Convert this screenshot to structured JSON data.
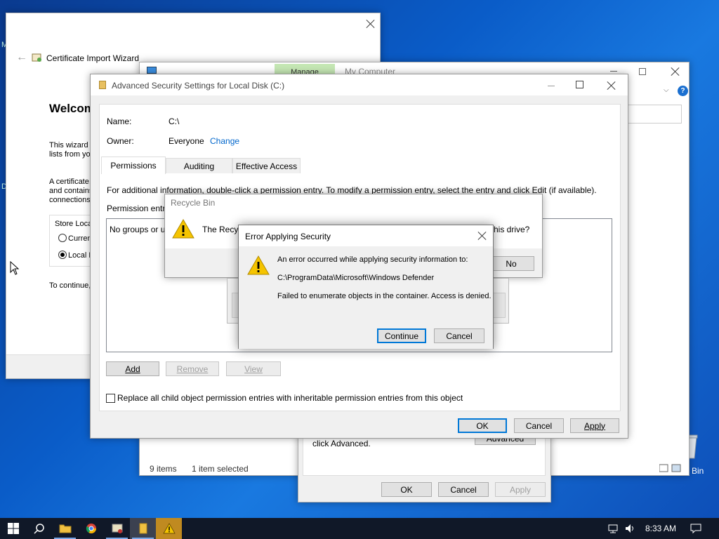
{
  "cert_wizard": {
    "title": "Certificate Import Wizard",
    "heading": "Welcom",
    "para1": "This wizard h lists from you",
    "para2": "A certificate, and contains connections.",
    "store_label": "Store Loca",
    "radio_current": "Curren",
    "radio_local": "Local M",
    "continue_text": "To continue,"
  },
  "explorer": {
    "manage_tab": "Manage",
    "location": "My Computer",
    "status_items": "9 items",
    "status_selected": "1 item selected"
  },
  "desktop": {
    "recycle_label": "Bin",
    "left_label_1": "M",
    "left_label_2": "D"
  },
  "properties": {
    "click_advanced": "click Advanced.",
    "advanced_button": "Advanced",
    "ok": "OK",
    "cancel": "Cancel",
    "apply": "Apply"
  },
  "advanced_security": {
    "title": "Advanced Security Settings for Local Disk (C:)",
    "name_label": "Name:",
    "name_value": "C:\\",
    "owner_label": "Owner:",
    "owner_value": "Everyone",
    "change_link": "Change",
    "tabs": [
      "Permissions",
      "Auditing",
      "Effective Access"
    ],
    "info_text": "For additional information, double-click a permission entry. To modify a permission entry, select the entry and click Edit (if available).",
    "permission_entries_label": "Permission entri",
    "no_groups_text": "No groups or u",
    "add_button": "Add",
    "remove_button": "Remove",
    "view_button": "View",
    "replace_checkbox_label": "Replace all child object permission entries with inheritable permission entries from this object",
    "ok": "OK",
    "cancel": "Cancel",
    "apply": "Apply"
  },
  "recycle_bin": {
    "title": "Recycle Bin",
    "message_start": "The Recyc",
    "message_end": "his drive?",
    "no_button": "No"
  },
  "error_dialog": {
    "title": "Error Applying Security",
    "line1": "An error occurred while applying security information to:",
    "line2": "C:\\ProgramData\\Microsoft\\Windows Defender",
    "line3": "Failed to enumerate objects in the container. Access is denied.",
    "continue_button": "Continue",
    "cancel_button": "Cancel"
  },
  "taskbar": {
    "time": "8:33 AM"
  },
  "colors": {
    "accent": "#0078d7",
    "link": "#0066cc",
    "manage_tab": "#c5e7b4",
    "warning": "#f5c400"
  }
}
